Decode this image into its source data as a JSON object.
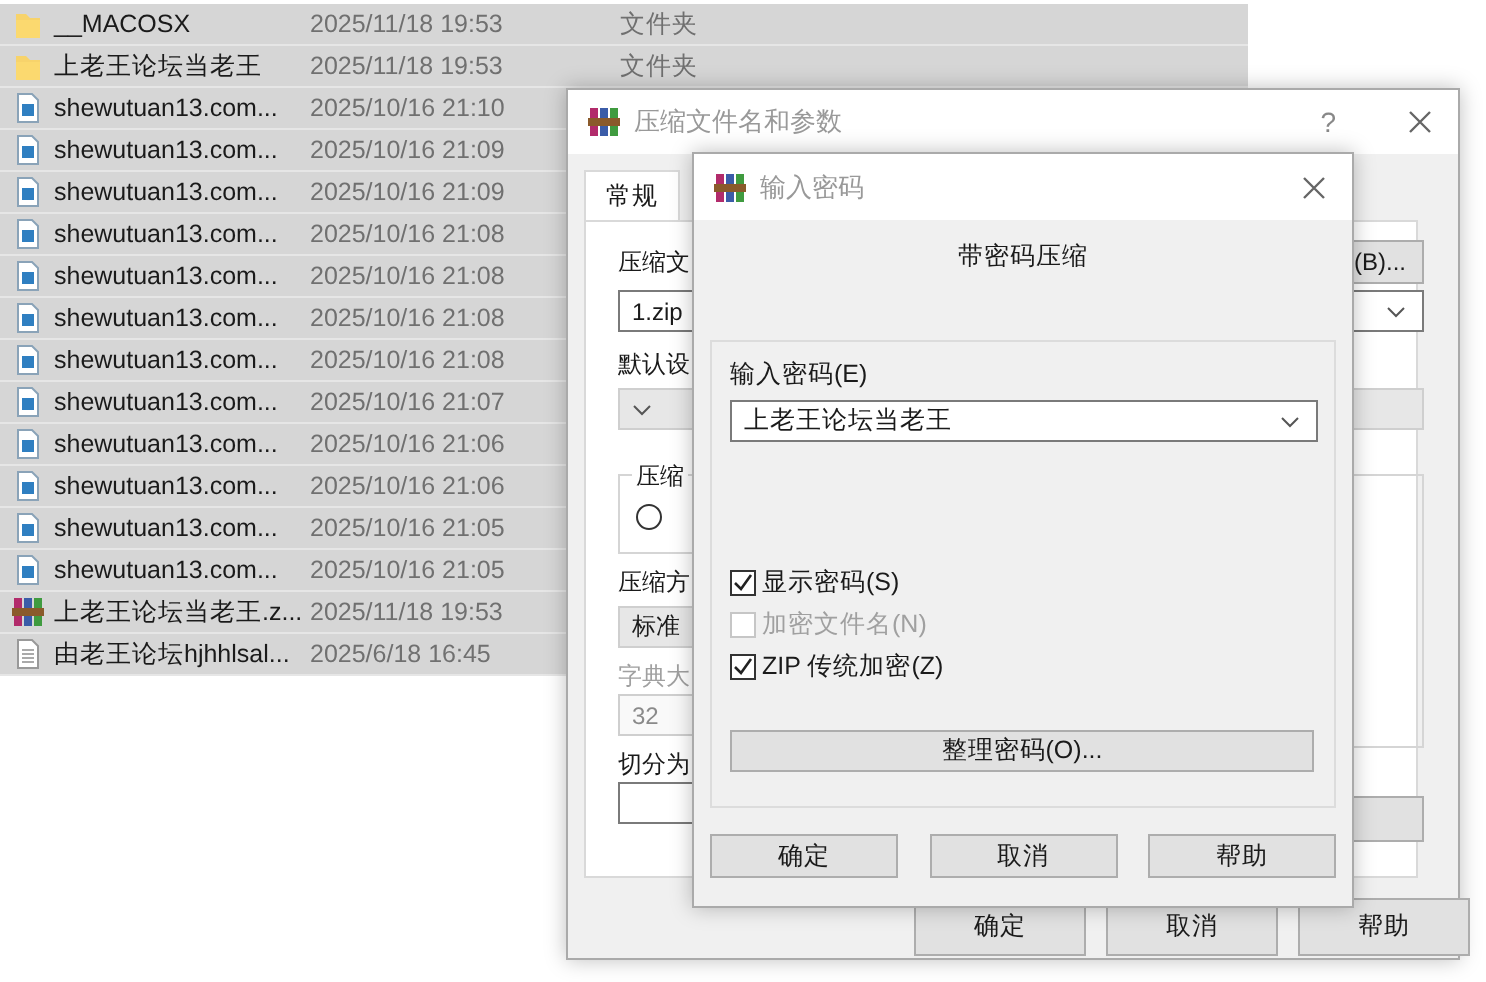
{
  "file_list": {
    "rows": [
      {
        "kind": "folder",
        "name": "__MACOSX",
        "modified": "2025/11/18 19:53",
        "type": "文件夹"
      },
      {
        "kind": "folder",
        "name": "上老王论坛当老王",
        "modified": "2025/11/18 19:53",
        "type": "文件夹"
      },
      {
        "kind": "media",
        "name": "shewutuan13.com...",
        "modified": "2025/10/16 21:10"
      },
      {
        "kind": "media",
        "name": "shewutuan13.com...",
        "modified": "2025/10/16 21:09"
      },
      {
        "kind": "media",
        "name": "shewutuan13.com...",
        "modified": "2025/10/16 21:09"
      },
      {
        "kind": "media",
        "name": "shewutuan13.com...",
        "modified": "2025/10/16 21:08"
      },
      {
        "kind": "media",
        "name": "shewutuan13.com...",
        "modified": "2025/10/16 21:08"
      },
      {
        "kind": "media",
        "name": "shewutuan13.com...",
        "modified": "2025/10/16 21:08"
      },
      {
        "kind": "media",
        "name": "shewutuan13.com...",
        "modified": "2025/10/16 21:08"
      },
      {
        "kind": "media",
        "name": "shewutuan13.com...",
        "modified": "2025/10/16 21:07"
      },
      {
        "kind": "media",
        "name": "shewutuan13.com...",
        "modified": "2025/10/16 21:06"
      },
      {
        "kind": "media",
        "name": "shewutuan13.com...",
        "modified": "2025/10/16 21:06"
      },
      {
        "kind": "media",
        "name": "shewutuan13.com...",
        "modified": "2025/10/16 21:05"
      },
      {
        "kind": "media",
        "name": "shewutuan13.com...",
        "modified": "2025/10/16 21:05"
      },
      {
        "kind": "archive",
        "name": "上老王论坛当老王.z...",
        "modified": "2025/11/18 19:53"
      },
      {
        "kind": "text",
        "name": "由老王论坛hjhhlsal...",
        "modified": "2025/6/18 16:45"
      }
    ]
  },
  "archive_dialog": {
    "title": "压缩文件名和参数",
    "help": "?",
    "tabs": [
      {
        "label": "常规",
        "selected": true
      }
    ],
    "archive_label": "压缩文",
    "browse_button": "(B)...",
    "archive_name": "1.zip",
    "profile_label": "默认设",
    "format_group_label": "压缩",
    "format_radio": {
      "selected": false
    },
    "method_label": "压缩方",
    "method": "标准",
    "dictionary": {
      "label": "字典大",
      "value": "32",
      "disabled": true
    },
    "split_label": "切分为",
    "buttons": [
      "确定",
      "取消",
      "帮助"
    ]
  },
  "password_dialog": {
    "title": "输入密码",
    "heading": "带密码压缩",
    "password_label": "输入密码(E)",
    "password": "上老王论坛当老王",
    "options": [
      {
        "label": "显示密码(S)",
        "checked": true,
        "disabled": false
      },
      {
        "label": "加密文件名(N)",
        "checked": false,
        "disabled": true
      },
      {
        "label": "ZIP 传统加密(Z)",
        "checked": true,
        "disabled": false
      }
    ],
    "organize_button": "整理密码(O)...",
    "buttons": [
      "确定",
      "取消",
      "帮助"
    ]
  }
}
